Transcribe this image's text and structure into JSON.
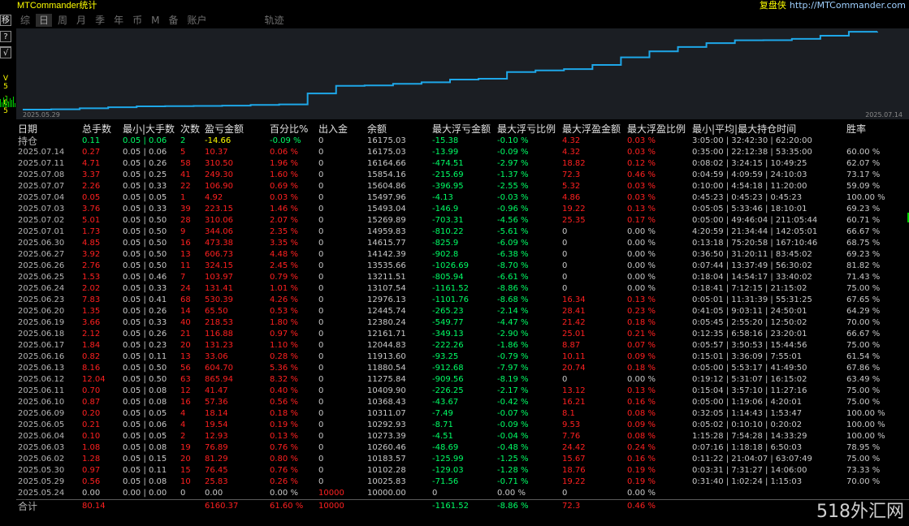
{
  "app": {
    "title": "MTCommander统计",
    "brand": "复盘侠",
    "url": "http://MTCommander.com"
  },
  "side": {
    "buttons": [
      "移",
      "?",
      "?",
      "√"
    ],
    "label": "V5.05"
  },
  "tabs": [
    {
      "label": "综",
      "active": false
    },
    {
      "label": "日",
      "active": true
    },
    {
      "label": "周",
      "active": false
    },
    {
      "label": "月",
      "active": false
    },
    {
      "label": "季",
      "active": false
    },
    {
      "label": "年",
      "active": false
    },
    {
      "label": "币",
      "active": false
    },
    {
      "label": "M",
      "active": false
    },
    {
      "label": "备",
      "active": false
    },
    {
      "label": "账户",
      "active": false
    },
    {
      "label": "轨迹",
      "active": false
    }
  ],
  "chart": {
    "start_label": "2025.05.29",
    "end_label": "2025.07.14",
    "line_color": "#1ea7e8"
  },
  "chart_data": {
    "type": "line",
    "series": [
      {
        "values": [
          10000,
          10025.83,
          10102.28,
          10183.57,
          10260.46,
          10273.39,
          10292.93,
          10311.07,
          10368.43,
          10409.9,
          11275.84,
          11880.54,
          11913.6,
          12044.83,
          12161.71,
          12380.24,
          12445.74,
          12976.13,
          13107.54,
          13211.51,
          13535.66,
          14142.39,
          14615.77,
          14959.83,
          15269.89,
          15493.04,
          15497.96,
          15604.86,
          15854.16,
          16164.66,
          16175.03
        ]
      }
    ]
  },
  "headers": [
    "日期",
    "总手数",
    "最小|大手数",
    "次数",
    "盈亏金额",
    "百分比%",
    "出入金",
    "余额",
    "最大浮亏金额",
    "最大浮亏比例",
    "最大浮盈金额",
    "最大浮盈比例",
    "最小|平均|最大持仓时间",
    "胜率"
  ],
  "holding": [
    "持仓",
    "0.11",
    "0.05 | 0.06",
    "2",
    "-14.66",
    "-0.09 %",
    "0",
    "16175.03",
    "-15.38",
    "-0.10 %",
    "4.32",
    "0.03 %",
    "3:05:00 | 32:42:30 | 62:20:00",
    ""
  ],
  "rows": [
    [
      "2025.07.14",
      "0.27",
      "0.05 | 0.06",
      "5",
      "10.37",
      "0.06 %",
      "0",
      "16175.03",
      "-13.99",
      "-0.09 %",
      "4.32",
      "0.03 %",
      "0:35:00 | 22:12:38 | 53:35:00",
      "60.00 %"
    ],
    [
      "2025.07.11",
      "4.71",
      "0.05 | 0.26",
      "58",
      "310.50",
      "1.96 %",
      "0",
      "16164.66",
      "-474.51",
      "-2.97 %",
      "18.82",
      "0.12 %",
      "0:08:02 | 3:24:15 | 10:49:25",
      "62.07 %"
    ],
    [
      "2025.07.08",
      "3.37",
      "0.05 | 0.25",
      "41",
      "249.30",
      "1.60 %",
      "0",
      "15854.16",
      "-215.69",
      "-1.37 %",
      "72.3",
      "0.46 %",
      "0:04:59 | 4:09:59 | 24:10:03",
      "73.17 %"
    ],
    [
      "2025.07.07",
      "2.26",
      "0.05 | 0.33",
      "22",
      "106.90",
      "0.69 %",
      "0",
      "15604.86",
      "-396.95",
      "-2.55 %",
      "5.32",
      "0.03 %",
      "0:10:00 | 4:54:18 | 11:20:00",
      "59.09 %"
    ],
    [
      "2025.07.04",
      "0.05",
      "0.05 | 0.05",
      "1",
      "4.92",
      "0.03 %",
      "0",
      "15497.96",
      "-4.13",
      "-0.03 %",
      "4.86",
      "0.03 %",
      "0:45:23 | 0:45:23 | 0:45:23",
      "100.00 %"
    ],
    [
      "2025.07.03",
      "3.76",
      "0.05 | 0.33",
      "39",
      "223.15",
      "1.46 %",
      "0",
      "15493.04",
      "-146.9",
      "-0.96 %",
      "19.22",
      "0.13 %",
      "0:05:05 | 5:33:46 | 18:10:01",
      "69.23 %"
    ],
    [
      "2025.07.02",
      "5.01",
      "0.05 | 0.50",
      "28",
      "310.06",
      "2.07 %",
      "0",
      "15269.89",
      "-703.31",
      "-4.56 %",
      "25.35",
      "0.17 %",
      "0:05:00 | 49:46:04 | 211:05:44",
      "60.71 %"
    ],
    [
      "2025.07.01",
      "1.73",
      "0.05 | 0.50",
      "9",
      "344.06",
      "2.35 %",
      "0",
      "14959.83",
      "-810.22",
      "-5.61 %",
      "0",
      "0.00 %",
      "4:20:59 | 21:34:44 | 142:05:01",
      "66.67 %"
    ],
    [
      "2025.06.30",
      "4.85",
      "0.05 | 0.50",
      "16",
      "473.38",
      "3.35 %",
      "0",
      "14615.77",
      "-825.9",
      "-6.09 %",
      "0",
      "0.00 %",
      "0:13:18 | 75:20:58 | 167:10:46",
      "68.75 %"
    ],
    [
      "2025.06.27",
      "3.92",
      "0.05 | 0.50",
      "13",
      "606.73",
      "4.48 %",
      "0",
      "14142.39",
      "-902.8",
      "-6.38 %",
      "0",
      "0.00 %",
      "0:36:50 | 31:20:11 | 83:45:02",
      "69.23 %"
    ],
    [
      "2025.06.26",
      "2.76",
      "0.05 | 0.50",
      "11",
      "324.15",
      "2.45 %",
      "0",
      "13535.66",
      "-1026.69",
      "-8.70 %",
      "0",
      "0.00 %",
      "0:07:44 | 13:37:49 | 56:30:02",
      "81.82 %"
    ],
    [
      "2025.06.25",
      "1.53",
      "0.05 | 0.46",
      "7",
      "103.97",
      "0.79 %",
      "0",
      "13211.51",
      "-805.94",
      "-6.61 %",
      "0",
      "0.00 %",
      "0:18:04 | 14:54:17 | 33:40:02",
      "71.43 %"
    ],
    [
      "2025.06.24",
      "2.02",
      "0.05 | 0.33",
      "24",
      "131.41",
      "1.01 %",
      "0",
      "13107.54",
      "-1161.52",
      "-8.86 %",
      "0",
      "0.00 %",
      "0:18:41 | 7:12:15 | 21:15:02",
      "75.00 %"
    ],
    [
      "2025.06.23",
      "7.83",
      "0.05 | 0.41",
      "68",
      "530.39",
      "4.26 %",
      "0",
      "12976.13",
      "-1101.76",
      "-8.68 %",
      "16.34",
      "0.13 %",
      "0:05:01 | 11:31:39 | 55:31:25",
      "67.65 %"
    ],
    [
      "2025.06.20",
      "1.35",
      "0.05 | 0.26",
      "14",
      "65.50",
      "0.53 %",
      "0",
      "12445.74",
      "-265.23",
      "-2.14 %",
      "28.41",
      "0.23 %",
      "0:41:05 | 9:03:11 | 24:50:01",
      "64.29 %"
    ],
    [
      "2025.06.19",
      "3.66",
      "0.05 | 0.33",
      "40",
      "218.53",
      "1.80 %",
      "0",
      "12380.24",
      "-549.77",
      "-4.47 %",
      "21.42",
      "0.18 %",
      "0:05:45 | 2:55:20 | 12:50:02",
      "70.00 %"
    ],
    [
      "2025.06.18",
      "2.12",
      "0.05 | 0.26",
      "21",
      "116.88",
      "0.97 %",
      "0",
      "12161.71",
      "-349.13",
      "-2.90 %",
      "25.01",
      "0.21 %",
      "0:12:35 | 6:58:16 | 23:20:01",
      "66.67 %"
    ],
    [
      "2025.06.17",
      "1.84",
      "0.05 | 0.23",
      "20",
      "131.23",
      "1.10 %",
      "0",
      "12044.83",
      "-222.26",
      "-1.86 %",
      "8.87",
      "0.07 %",
      "0:05:57 | 3:50:53 | 15:44:56",
      "75.00 %"
    ],
    [
      "2025.06.16",
      "0.82",
      "0.05 | 0.11",
      "13",
      "33.06",
      "0.28 %",
      "0",
      "11913.60",
      "-93.25",
      "-0.79 %",
      "10.11",
      "0.09 %",
      "0:15:01 | 3:36:09 | 7:55:01",
      "61.54 %"
    ],
    [
      "2025.06.13",
      "8.16",
      "0.05 | 0.50",
      "56",
      "604.70",
      "5.36 %",
      "0",
      "11880.54",
      "-912.68",
      "-7.97 %",
      "20.74",
      "0.18 %",
      "0:05:00 | 5:53:17 | 41:49:50",
      "67.86 %"
    ],
    [
      "2025.06.12",
      "12.04",
      "0.05 | 0.50",
      "63",
      "865.94",
      "8.32 %",
      "0",
      "11275.84",
      "-909.56",
      "-8.19 %",
      "0",
      "0.00 %",
      "0:19:12 | 5:31:07 | 16:15:02",
      "63.49 %"
    ],
    [
      "2025.06.11",
      "0.70",
      "0.05 | 0.08",
      "12",
      "41.47",
      "0.40 %",
      "0",
      "10409.90",
      "-226.25",
      "-2.17 %",
      "13.12",
      "0.13 %",
      "0:15:04 | 3:57:10 | 11:27:16",
      "75.00 %"
    ],
    [
      "2025.06.10",
      "0.87",
      "0.05 | 0.08",
      "16",
      "57.36",
      "0.56 %",
      "0",
      "10368.43",
      "-43.67",
      "-0.42 %",
      "16.21",
      "0.16 %",
      "0:05:00 | 1:19:06 | 4:20:01",
      "75.00 %"
    ],
    [
      "2025.06.09",
      "0.20",
      "0.05 | 0.05",
      "4",
      "18.14",
      "0.18 %",
      "0",
      "10311.07",
      "-7.49",
      "-0.07 %",
      "8.1",
      "0.08 %",
      "0:32:05 | 1:14:43 | 1:53:47",
      "100.00 %"
    ],
    [
      "2025.06.05",
      "0.21",
      "0.05 | 0.06",
      "4",
      "19.54",
      "0.19 %",
      "0",
      "10292.93",
      "-8.71",
      "-0.09 %",
      "9.53",
      "0.09 %",
      "0:05:02 | 0:10:10 | 0:20:02",
      "100.00 %"
    ],
    [
      "2025.06.04",
      "0.10",
      "0.05 | 0.05",
      "2",
      "12.93",
      "0.13 %",
      "0",
      "10273.39",
      "-4.51",
      "-0.04 %",
      "7.76",
      "0.08 %",
      "1:15:28 | 7:54:28 | 14:33:29",
      "100.00 %"
    ],
    [
      "2025.06.03",
      "1.08",
      "0.05 | 0.08",
      "19",
      "76.89",
      "0.76 %",
      "0",
      "10260.46",
      "-48.69",
      "-0.48 %",
      "24.42",
      "0.24 %",
      "0:07:16 | 1:18:18 | 6:50:03",
      "78.95 %"
    ],
    [
      "2025.06.02",
      "1.28",
      "0.05 | 0.15",
      "20",
      "81.29",
      "0.80 %",
      "0",
      "10183.57",
      "-125.99",
      "-1.25 %",
      "15.67",
      "0.16 %",
      "0:11:22 | 21:04:07 | 63:07:49",
      "75.00 %"
    ],
    [
      "2025.05.30",
      "0.97",
      "0.05 | 0.11",
      "15",
      "76.45",
      "0.76 %",
      "0",
      "10102.28",
      "-129.03",
      "-1.28 %",
      "18.76",
      "0.19 %",
      "0:03:31 | 7:31:27 | 14:06:00",
      "73.33 %"
    ],
    [
      "2025.05.29",
      "0.56",
      "0.05 | 0.08",
      "10",
      "25.83",
      "0.26 %",
      "0",
      "10025.83",
      "-71.56",
      "-0.71 %",
      "19.22",
      "0.19 %",
      "0:31:40 | 1:02:24 | 1:15:03",
      "70.00 %"
    ],
    [
      "2025.05.24",
      "0.00",
      "0.00 | 0.00",
      "0",
      "0.00",
      "0.00 %",
      "10000",
      "10000.00",
      "0",
      "0.00 %",
      "0",
      "0.00 %",
      "",
      ""
    ]
  ],
  "total": [
    "合计",
    "80.14",
    "",
    "",
    "6160.37",
    "61.60 %",
    "10000",
    "",
    "-1161.52",
    "-8.86 %",
    "72.3",
    "0.46 %",
    "",
    ""
  ],
  "watermark": "518外汇网"
}
